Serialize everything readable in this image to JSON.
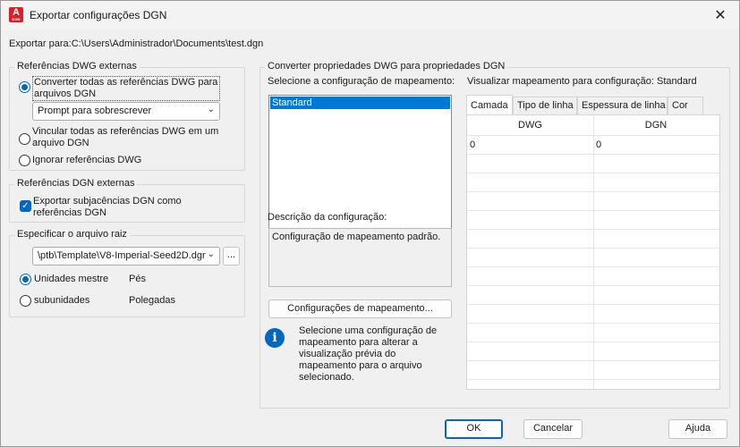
{
  "window": {
    "title": "Exportar configurações DGN",
    "app_icon_letter": "A",
    "app_icon_sub": "DGN",
    "close_glyph": "✕"
  },
  "export_to": {
    "text": "Exportar para:C:\\Users\\Administrador\\Documents\\test.dgn"
  },
  "dwg_refs": {
    "title": "Referências DWG externas",
    "option_convert": "Converter todas as referências DWG para arquivos DGN",
    "prompt_combo": "Prompt para sobrescrever",
    "option_link": "Vincular todas as referências DWG em um arquivo DGN",
    "option_ignore": "Ignorar referências DWG",
    "selected": "convert"
  },
  "dgn_refs": {
    "title": "Referências DGN externas",
    "export_underlays": "Exportar subjacências DGN como referências DGN",
    "checked": true
  },
  "seed": {
    "title": "Especificar o arquivo raiz",
    "path": "\\ptb\\Template\\V8-Imperial-Seed2D.dgn",
    "browse": "...",
    "master_units_label": "Unidades mestre",
    "master_units_value": "Pés",
    "sub_units_label": "subunidades",
    "sub_units_value": "Polegadas",
    "selected": "master"
  },
  "convert_props": {
    "title": "Converter propriedades DWG para propriedades DGN",
    "select_label": "Selecione a configuração de  mapeamento:",
    "setups": [
      "Standard"
    ],
    "preview_label": "Visualizar mapeamento para configuração: Standard",
    "description_label": "Descrição da configuração:",
    "description_text": "Configuração de mapeamento padrão.",
    "mapping_button": "Configurações de mapeamento...",
    "info_text": "Selecione uma configuração de mapeamento para alterar a visualização prévia do mapeamento para o arquivo selecionado.",
    "info_glyph": "i",
    "tabs": [
      "Camada",
      "Tipo de linha",
      "Espessura de linha",
      "Cor"
    ],
    "active_tab": 0,
    "grid": {
      "headers": [
        "DWG",
        "DGN"
      ],
      "rows": [
        [
          "0",
          "0"
        ]
      ]
    }
  },
  "footer": {
    "ok": "OK",
    "cancel": "Cancelar",
    "help": "Ajuda"
  },
  "colors": {
    "accent": "#0067c0",
    "selection": "#0078d7",
    "app_icon": "#d6202a"
  }
}
